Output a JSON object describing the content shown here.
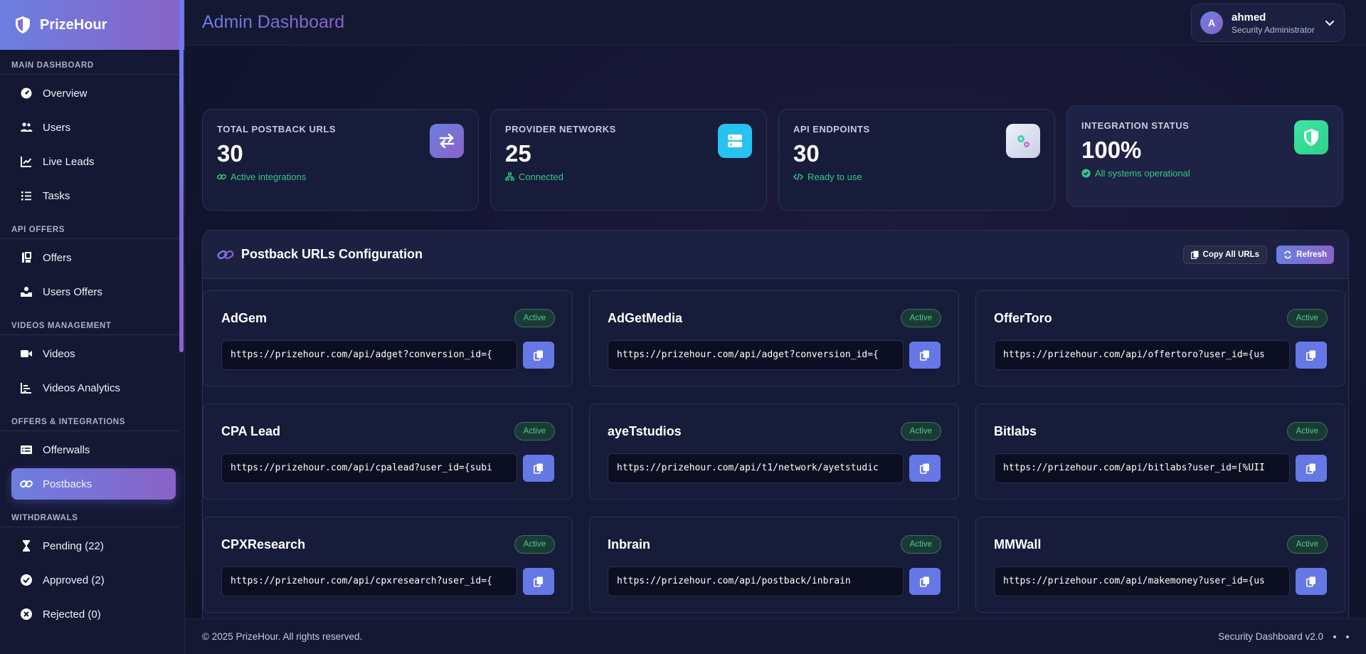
{
  "brand": {
    "name": "PrizeHour"
  },
  "header": {
    "title": "Admin Dashboard",
    "user": {
      "initial": "A",
      "name": "ahmed",
      "role": "Security Administrator"
    }
  },
  "sidebar": {
    "sections": [
      {
        "title": "MAIN DASHBOARD",
        "items": [
          {
            "label": "Overview",
            "icon": "speedometer-icon"
          },
          {
            "label": "Users",
            "icon": "users-icon"
          },
          {
            "label": "Live Leads",
            "icon": "line-chart-icon"
          },
          {
            "label": "Tasks",
            "icon": "tasks-icon"
          }
        ]
      },
      {
        "title": "API OFFERS",
        "items": [
          {
            "label": "Offers",
            "icon": "offers-icon"
          },
          {
            "label": "Users Offers",
            "icon": "inbox-user-icon"
          }
        ]
      },
      {
        "title": "VIDEOS MANAGEMENT",
        "items": [
          {
            "label": "Videos",
            "icon": "video-icon"
          },
          {
            "label": "Videos Analytics",
            "icon": "bar-analytics-icon"
          }
        ]
      },
      {
        "title": "OFFERS & INTEGRATIONS",
        "items": [
          {
            "label": "Offerwalls",
            "icon": "list-icon"
          },
          {
            "label": "Postbacks",
            "icon": "link-icon",
            "active": true
          }
        ]
      },
      {
        "title": "WITHDRAWALS",
        "items": [
          {
            "label": "Pending (22)",
            "icon": "hourglass-icon"
          },
          {
            "label": "Approved (2)",
            "icon": "check-circle-icon"
          },
          {
            "label": "Rejected (0)",
            "icon": "x-circle-icon"
          }
        ]
      }
    ]
  },
  "stats": [
    {
      "label": "TOTAL POSTBACK URLS",
      "value": "30",
      "sub": "Active integrations",
      "icon": "exchange-icon",
      "color": "#7b6fdc"
    },
    {
      "label": "PROVIDER NETWORKS",
      "value": "25",
      "sub": "Connected",
      "icon": "server-icon",
      "color": "#27c3f0"
    },
    {
      "label": "API ENDPOINTS",
      "value": "30",
      "sub": "Ready to use",
      "icon": "gears-icon",
      "color": "#d9dff0"
    },
    {
      "label": "INTEGRATION STATUS",
      "value": "100%",
      "sub": "All systems operational",
      "icon": "shield-icon",
      "color": "#3de6a3"
    }
  ],
  "postbacks": {
    "title": "Postback URLs Configuration",
    "copy_all_label": "Copy All URLs",
    "refresh_label": "Refresh",
    "status_label": "Active",
    "items": [
      {
        "name": "AdGem",
        "url": "https://prizehour.com/api/adget?conversion_id={"
      },
      {
        "name": "AdGetMedia",
        "url": "https://prizehour.com/api/adget?conversion_id={"
      },
      {
        "name": "OfferToro",
        "url": "https://prizehour.com/api/offertoro?user_id={us"
      },
      {
        "name": "CPA Lead",
        "url": "https://prizehour.com/api/cpalead?user_id={subi"
      },
      {
        "name": "ayeTstudios",
        "url": "https://prizehour.com/api/t1/network/ayetstudic"
      },
      {
        "name": "Bitlabs",
        "url": "https://prizehour.com/api/bitlabs?user_id=[%UII"
      },
      {
        "name": "CPXResearch",
        "url": "https://prizehour.com/api/cpxresearch?user_id={"
      },
      {
        "name": "Inbrain",
        "url": "https://prizehour.com/api/postback/inbrain"
      },
      {
        "name": "MMWall",
        "url": "https://prizehour.com/api/makemoney?user_id={us"
      }
    ]
  },
  "footer": {
    "copyright": "© 2025 PrizeHour. All rights reserved.",
    "version": "Security Dashboard v2.0"
  }
}
